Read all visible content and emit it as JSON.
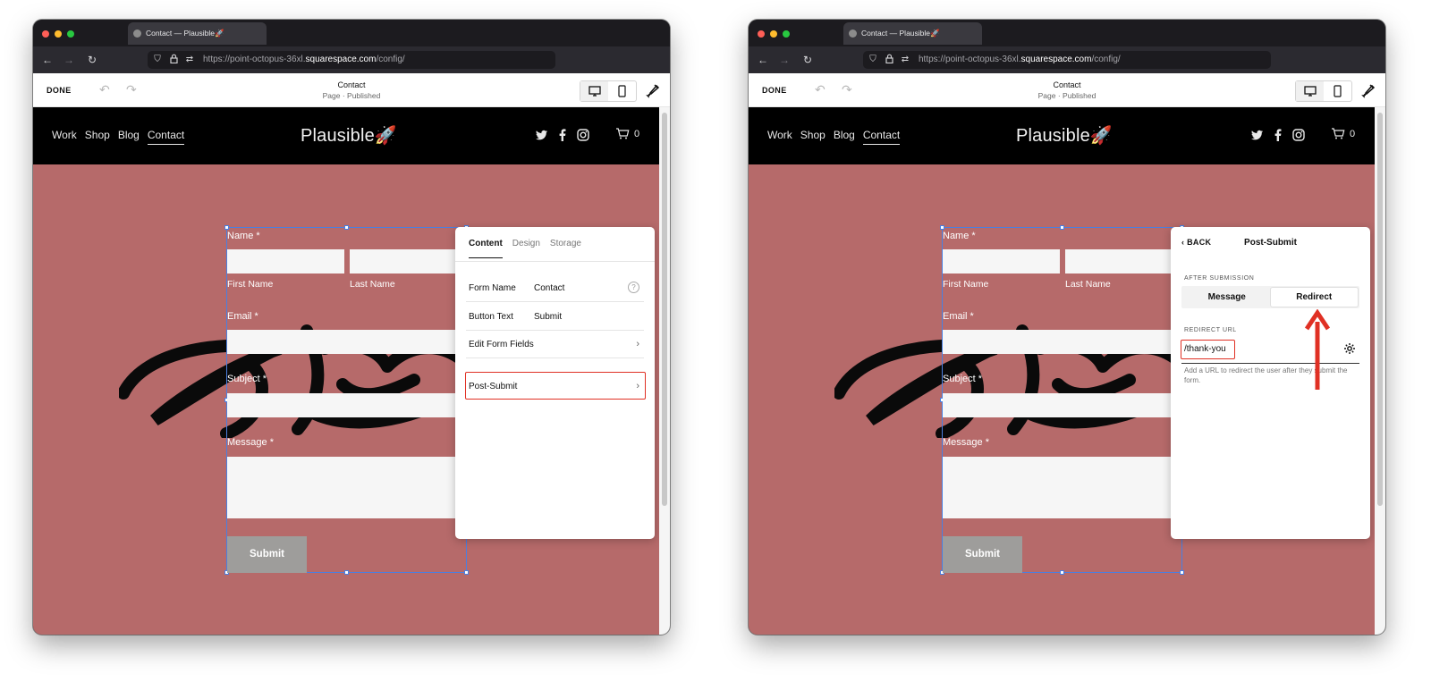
{
  "browser": {
    "tab_title": "Contact — Plausible🚀",
    "url_prefix": "https://point-octopus-36xl.",
    "url_domain": "squarespace.com",
    "url_path": "/config/"
  },
  "toolbar": {
    "done_label": "DONE",
    "page_title": "Contact",
    "page_status": "Page · Published"
  },
  "site": {
    "nav": [
      "Work",
      "Shop",
      "Blog",
      "Contact"
    ],
    "logo": "Plausible🚀",
    "cart_count": "0"
  },
  "form": {
    "name_label": "Name *",
    "first_name": "First Name",
    "last_name": "Last Name",
    "email_label": "Email *",
    "subject_label": "Subject *",
    "message_label": "Message *",
    "submit": "Submit"
  },
  "content_panel": {
    "tabs": [
      "Content",
      "Design",
      "Storage"
    ],
    "form_name_label": "Form Name",
    "form_name_value": "Contact",
    "button_text_label": "Button Text",
    "button_text_value": "Submit",
    "edit_fields": "Edit Form Fields",
    "post_submit": "Post-Submit",
    "help_glyph": "?"
  },
  "post_submit_panel": {
    "back": "BACK",
    "title": "Post-Submit",
    "after_label": "AFTER SUBMISSION",
    "options": [
      "Message",
      "Redirect"
    ],
    "selected": "Redirect",
    "redirect_label": "REDIRECT URL",
    "redirect_value": "/thank-you",
    "help": "Add a URL to redirect the user after they submit the form."
  },
  "colors": {
    "site_bg": "#b66a6a",
    "highlight": "#e03024",
    "selection": "#4a7fe0"
  }
}
